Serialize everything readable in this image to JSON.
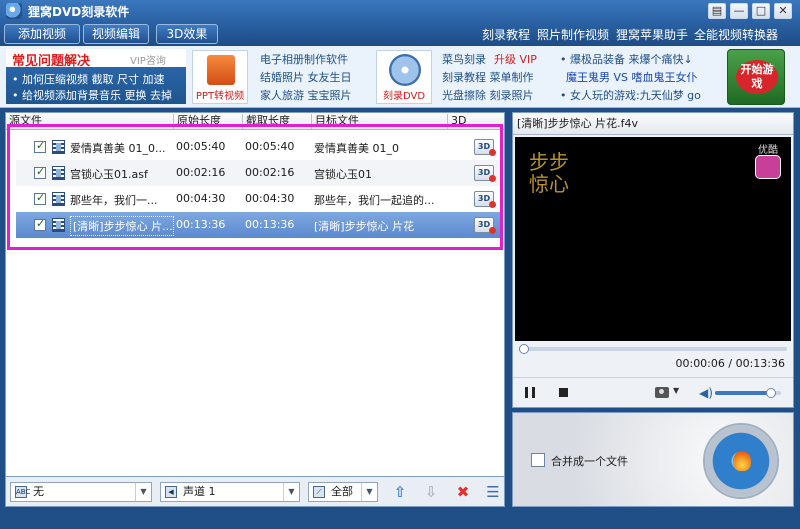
{
  "app": {
    "title": "狸窝DVD刻录软件"
  },
  "window_buttons": {
    "menu": "▤",
    "minimize": "—",
    "maximize": "□",
    "close": "✕"
  },
  "toolbar": {
    "buttons": [
      "添加视频",
      "视频编辑",
      "3D效果"
    ],
    "links": [
      "刻录教程",
      "照片制作视频",
      "狸窝苹果助手",
      "全能视频转换器"
    ]
  },
  "ads": {
    "faq_title": "常见问题解决",
    "faq_vip": "VIP咨询",
    "faq_lines": [
      "• 加何压缩视频  截取  尺寸  加速",
      "• 给视频添加背景音乐  更换  去掉"
    ],
    "tile1_caption": "PPT转视频",
    "group1": [
      "电子相册制作软件",
      "结婚照片  女友生日",
      "家人旅游  宝宝照片"
    ],
    "tile2_caption": "刻录DVD",
    "group2": [
      "菜鸟刻录",
      "升级 VIP",
      "刻录教程  菜单制作",
      "光盘擦除  刻录照片"
    ],
    "group3": [
      "• 爆极品装备  来爆个痛快↓",
      "魔王鬼男  VS  嗜血鬼王女仆",
      "• 女人玩的游戏:九天仙梦  go"
    ],
    "start_game": "开始游戏"
  },
  "list": {
    "columns": [
      "源文件",
      "原始长度",
      "截取长度",
      "目标文件",
      "3D"
    ],
    "rows": [
      {
        "source": "爱情真善美 01_0...",
        "original": "00:05:40",
        "clip": "00:05:40",
        "target": "爱情真善美 01_0",
        "badge": "3D"
      },
      {
        "source": "宫锁心玉01.asf",
        "original": "00:02:16",
        "clip": "00:02:16",
        "target": "宫锁心玉01",
        "badge": "3D"
      },
      {
        "source": "那些年，我们一...",
        "original": "00:04:30",
        "clip": "00:04:30",
        "target": "那些年，我们一起追的...",
        "badge": "3D"
      },
      {
        "source": "[清晰]步步惊心 片...",
        "original": "00:13:36",
        "clip": "00:13:36",
        "target": "[清晰]步步惊心 片花",
        "badge": "3D"
      }
    ]
  },
  "bottom": {
    "subtitle_icon": "ABC",
    "subtitle": "无",
    "audio": "声道 1",
    "apply": "全部"
  },
  "preview": {
    "title": "[清晰]步步惊心 片花.f4v",
    "video_logo": "步步惊心",
    "watermark": "优酷",
    "time": "00:00:06 / 00:13:36",
    "progress": 0.007,
    "volume": 0.85
  },
  "burn": {
    "merge_label": "合并成一个文件"
  },
  "colors": {
    "accent": "#2a62a4",
    "highlight": "#e020d0",
    "selected_row": "#5b89cf"
  }
}
